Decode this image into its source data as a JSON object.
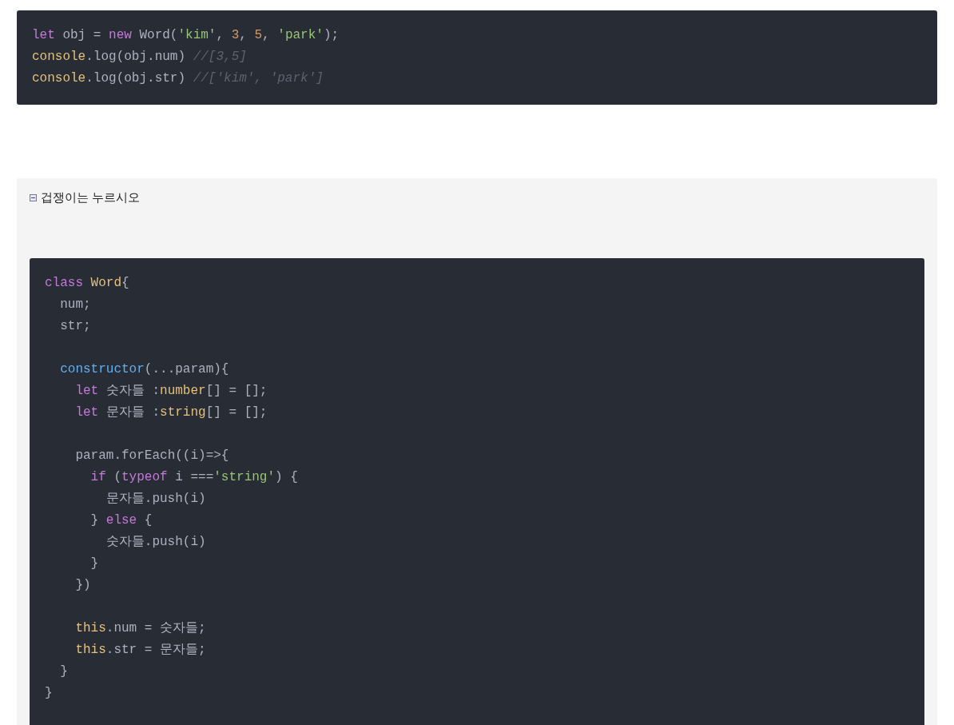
{
  "example_code": {
    "lines": [
      {
        "kind": "code",
        "tokens": [
          {
            "kind": "keyword",
            "text": "let"
          },
          {
            "kind": "plain",
            "text": " obj = "
          },
          {
            "kind": "keyword",
            "text": "new"
          },
          {
            "kind": "plain",
            "text": " Word("
          },
          {
            "kind": "string",
            "text": "'kim'"
          },
          {
            "kind": "plain",
            "text": ", "
          },
          {
            "kind": "number",
            "text": "3"
          },
          {
            "kind": "plain",
            "text": ", "
          },
          {
            "kind": "number",
            "text": "5"
          },
          {
            "kind": "plain",
            "text": ", "
          },
          {
            "kind": "string",
            "text": "'park'"
          },
          {
            "kind": "plain",
            "text": ");"
          }
        ]
      },
      {
        "kind": "code",
        "tokens": [
          {
            "kind": "builtin",
            "text": "console"
          },
          {
            "kind": "plain",
            "text": ".log(obj.num) "
          },
          {
            "kind": "comment",
            "text": "//[3,5]"
          }
        ]
      },
      {
        "kind": "code",
        "tokens": [
          {
            "kind": "builtin",
            "text": "console"
          },
          {
            "kind": "plain",
            "text": ".log(obj.str) "
          },
          {
            "kind": "comment",
            "text": "//['kim', 'park']"
          }
        ]
      }
    ]
  },
  "toggle": {
    "label": "겁쟁이는 누르시오",
    "expanded": true,
    "code": {
      "lines": [
        {
          "kind": "code",
          "tokens": [
            {
              "kind": "keyword",
              "text": "class"
            },
            {
              "kind": "builtin",
              "text": " Word"
            },
            {
              "kind": "plain",
              "text": "{"
            }
          ]
        },
        {
          "kind": "code",
          "tokens": [
            {
              "kind": "plain",
              "text": "  num;"
            }
          ]
        },
        {
          "kind": "code",
          "tokens": [
            {
              "kind": "plain",
              "text": "  str;"
            }
          ]
        },
        {
          "kind": "blank"
        },
        {
          "kind": "code",
          "tokens": [
            {
              "kind": "function",
              "text": "  constructor"
            },
            {
              "kind": "plain",
              "text": "(...param){"
            }
          ]
        },
        {
          "kind": "code",
          "tokens": [
            {
              "kind": "keyword",
              "text": "    let"
            },
            {
              "kind": "plain",
              "text": " 숫자들 :"
            },
            {
              "kind": "builtin",
              "text": "number"
            },
            {
              "kind": "plain",
              "text": "[] = [];"
            }
          ]
        },
        {
          "kind": "code",
          "tokens": [
            {
              "kind": "keyword",
              "text": "    let"
            },
            {
              "kind": "plain",
              "text": " 문자들 :"
            },
            {
              "kind": "builtin",
              "text": "string"
            },
            {
              "kind": "plain",
              "text": "[] = [];"
            }
          ]
        },
        {
          "kind": "blank"
        },
        {
          "kind": "code",
          "tokens": [
            {
              "kind": "plain",
              "text": "    param.forEach((i)=>{"
            }
          ]
        },
        {
          "kind": "code",
          "tokens": [
            {
              "kind": "keyword",
              "text": "      if"
            },
            {
              "kind": "plain",
              "text": " ("
            },
            {
              "kind": "keyword",
              "text": "typeof"
            },
            {
              "kind": "plain",
              "text": " i ==="
            },
            {
              "kind": "string",
              "text": "'string'"
            },
            {
              "kind": "plain",
              "text": ") {"
            }
          ]
        },
        {
          "kind": "code",
          "tokens": [
            {
              "kind": "plain",
              "text": "        문자들.push(i)"
            }
          ]
        },
        {
          "kind": "code",
          "tokens": [
            {
              "kind": "plain",
              "text": "      } "
            },
            {
              "kind": "keyword",
              "text": "else"
            },
            {
              "kind": "plain",
              "text": " {"
            }
          ]
        },
        {
          "kind": "code",
          "tokens": [
            {
              "kind": "plain",
              "text": "        숫자들.push(i)"
            }
          ]
        },
        {
          "kind": "code",
          "tokens": [
            {
              "kind": "plain",
              "text": "      }"
            }
          ]
        },
        {
          "kind": "code",
          "tokens": [
            {
              "kind": "plain",
              "text": "    })"
            }
          ]
        },
        {
          "kind": "blank"
        },
        {
          "kind": "code",
          "tokens": [
            {
              "kind": "builtin",
              "text": "    this"
            },
            {
              "kind": "plain",
              "text": ".num = 숫자들;"
            }
          ]
        },
        {
          "kind": "code",
          "tokens": [
            {
              "kind": "builtin",
              "text": "    this"
            },
            {
              "kind": "plain",
              "text": ".str = 문자들;"
            }
          ]
        },
        {
          "kind": "code",
          "tokens": [
            {
              "kind": "plain",
              "text": "  }"
            }
          ]
        },
        {
          "kind": "code",
          "tokens": [
            {
              "kind": "plain",
              "text": "}"
            }
          ]
        }
      ]
    }
  }
}
